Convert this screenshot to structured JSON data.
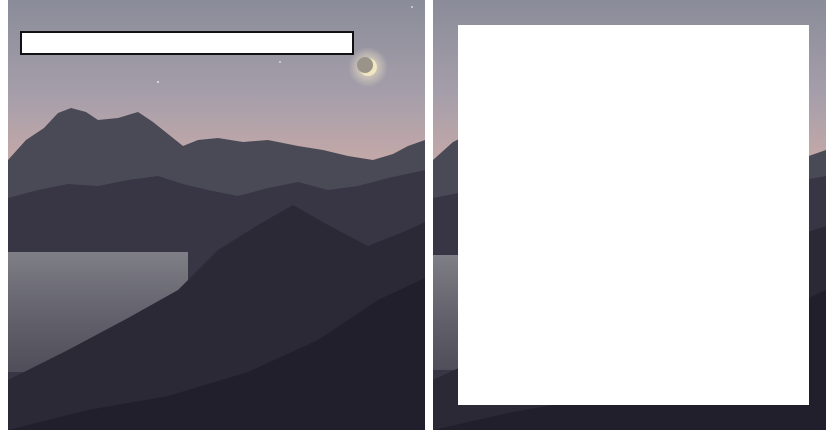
{
  "left_panel": {
    "text_box_value": ""
  },
  "colors": {
    "sky_top": "#8a8c99",
    "sky_mid": "#a59eaa",
    "sky_horizon": "#c8aaa8",
    "far_ridge": "#4a4a57",
    "mid_ridge": "#383644",
    "near_slope": "#2c2937",
    "foreground": "#221f2c",
    "fog": "#7e7e86",
    "moon": "#f1e6c2",
    "mask": "#ffffff"
  },
  "icons": {
    "moon": "crescent-moon"
  }
}
